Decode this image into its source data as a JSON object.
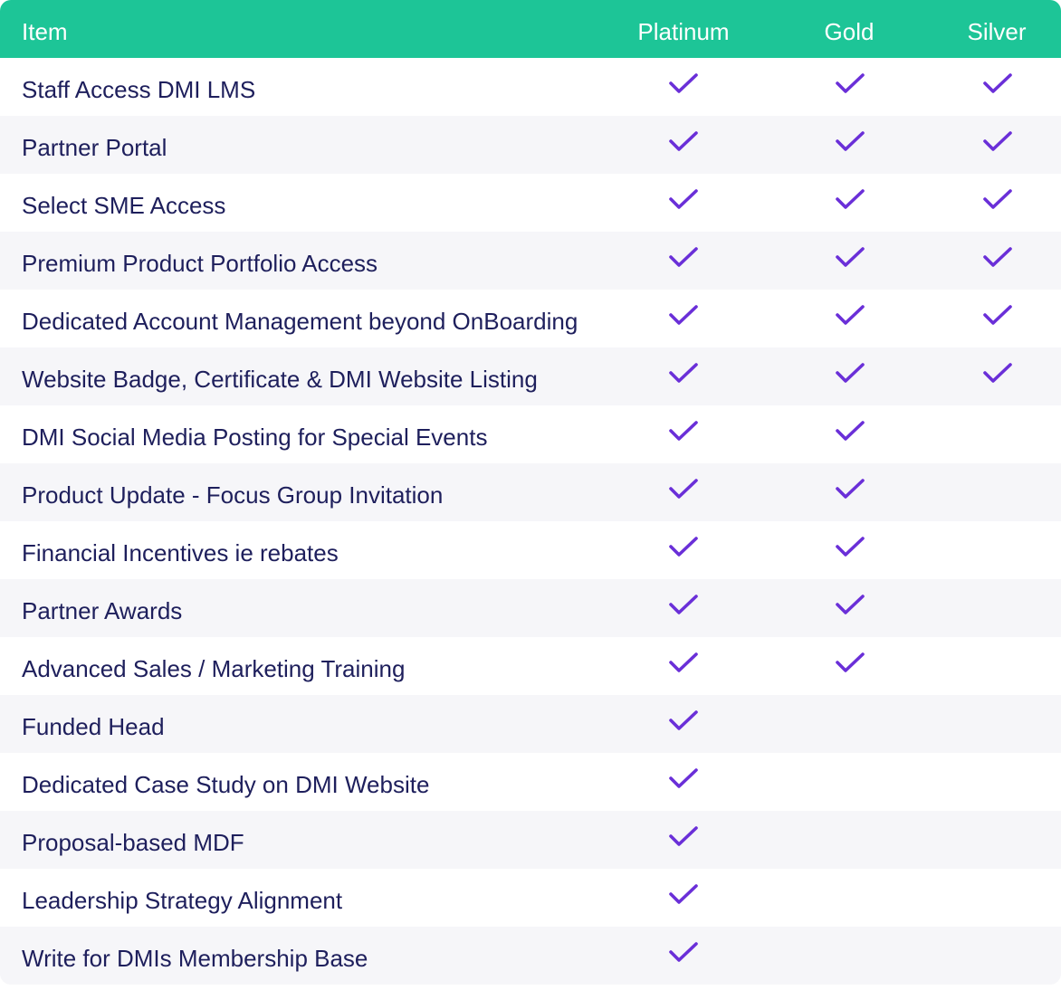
{
  "colors": {
    "header_bg": "#1dc597",
    "header_text": "#ffffff",
    "row_text": "#1e1f5c",
    "row_alt_bg": "#f6f6f9",
    "check": "#6a2fd8"
  },
  "icons": {
    "included": "checkmark-icon"
  },
  "header": {
    "item": "Item",
    "tiers": [
      "Platinum",
      "Gold",
      "Silver"
    ]
  },
  "rows": [
    {
      "label": "Staff Access DMI LMS",
      "platinum": true,
      "gold": true,
      "silver": true
    },
    {
      "label": "Partner Portal",
      "platinum": true,
      "gold": true,
      "silver": true
    },
    {
      "label": "Select SME Access",
      "platinum": true,
      "gold": true,
      "silver": true
    },
    {
      "label": "Premium Product Portfolio Access",
      "platinum": true,
      "gold": true,
      "silver": true
    },
    {
      "label": "Dedicated Account Management beyond OnBoarding",
      "platinum": true,
      "gold": true,
      "silver": true
    },
    {
      "label": "Website Badge, Certificate & DMI Website Listing",
      "platinum": true,
      "gold": true,
      "silver": true
    },
    {
      "label": "DMI Social Media Posting for Special Events",
      "platinum": true,
      "gold": true,
      "silver": false
    },
    {
      "label": "Product Update - Focus Group Invitation",
      "platinum": true,
      "gold": true,
      "silver": false
    },
    {
      "label": "Financial Incentives ie rebates",
      "platinum": true,
      "gold": true,
      "silver": false
    },
    {
      "label": "Partner Awards",
      "platinum": true,
      "gold": true,
      "silver": false
    },
    {
      "label": "Advanced Sales / Marketing Training",
      "platinum": true,
      "gold": true,
      "silver": false
    },
    {
      "label": "Funded Head",
      "platinum": true,
      "gold": false,
      "silver": false
    },
    {
      "label": "Dedicated Case Study on DMI Website",
      "platinum": true,
      "gold": false,
      "silver": false
    },
    {
      "label": "Proposal-based MDF",
      "platinum": true,
      "gold": false,
      "silver": false
    },
    {
      "label": "Leadership Strategy Alignment",
      "platinum": true,
      "gold": false,
      "silver": false
    },
    {
      "label": "Write for DMIs Membership Base",
      "platinum": true,
      "gold": false,
      "silver": false
    }
  ]
}
